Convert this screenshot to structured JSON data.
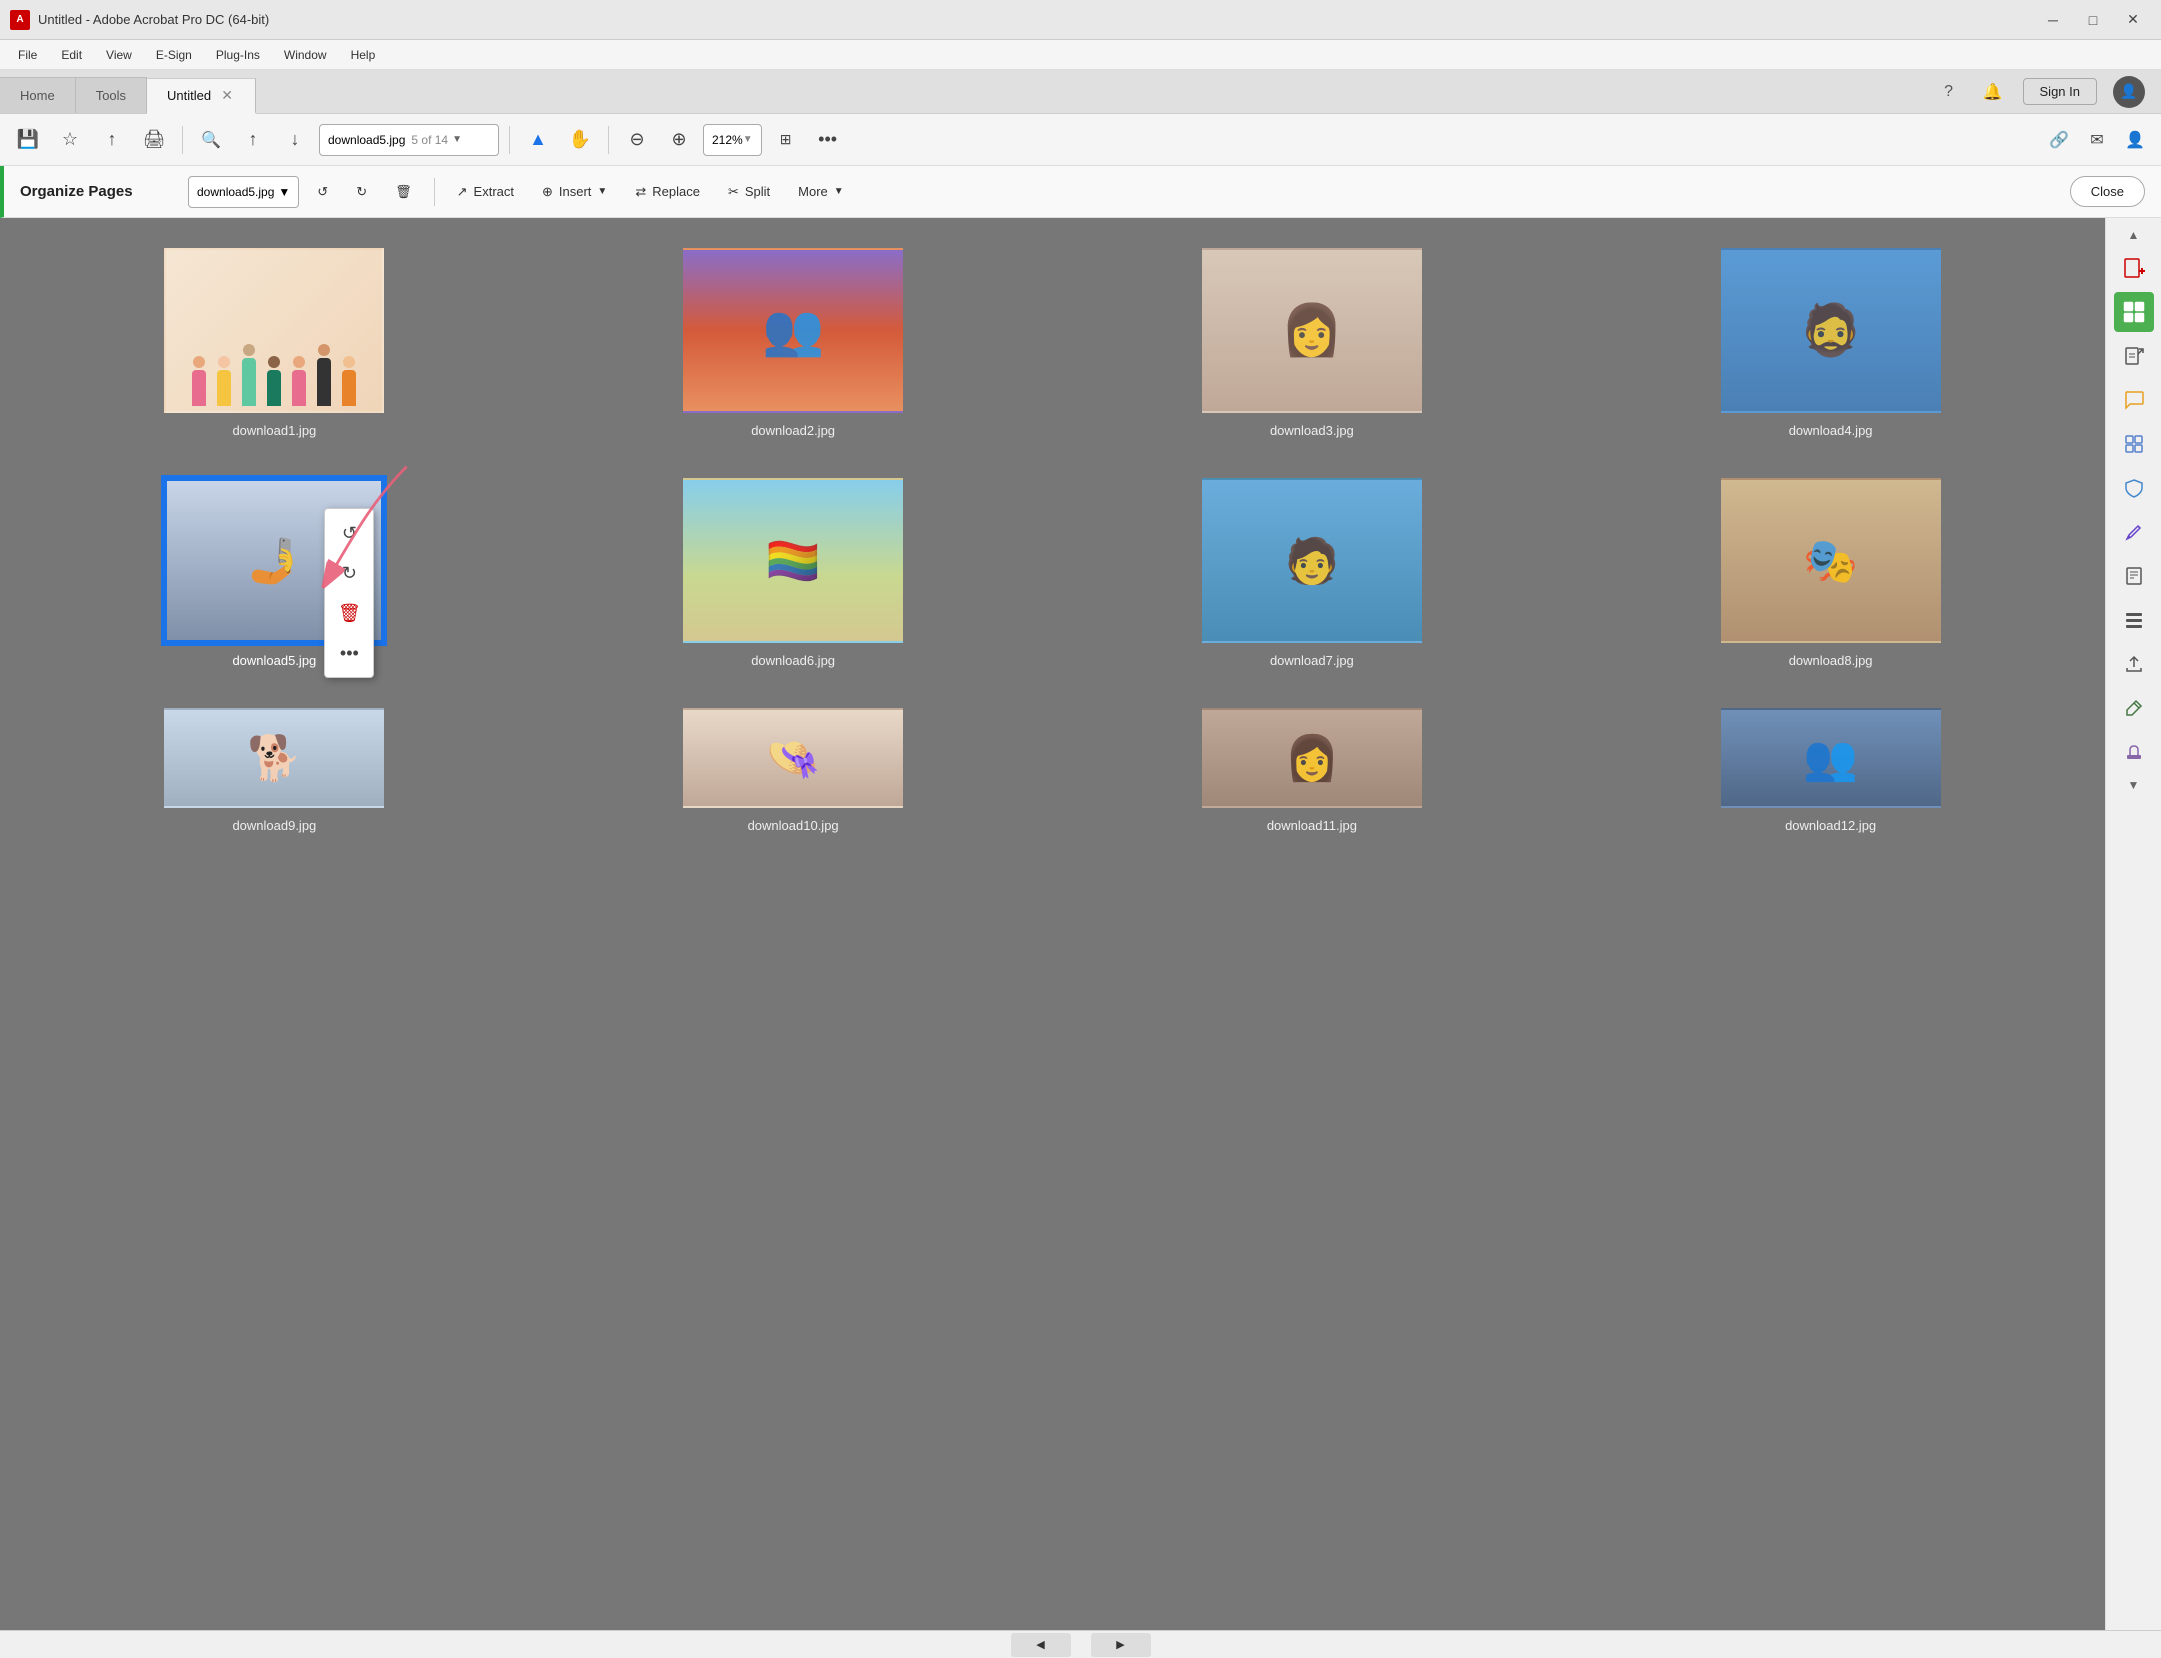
{
  "window": {
    "title": "Untitled - Adobe Acrobat Pro DC (64-bit)",
    "icon": "A",
    "controls": [
      "minimize",
      "maximize",
      "close"
    ]
  },
  "menubar": {
    "items": [
      "File",
      "Edit",
      "View",
      "E-Sign",
      "Plug-Ins",
      "Window",
      "Help"
    ]
  },
  "tabs": {
    "items": [
      {
        "label": "Home",
        "active": false,
        "closable": false
      },
      {
        "label": "Tools",
        "active": false,
        "closable": false
      },
      {
        "label": "Untitled",
        "active": true,
        "closable": true
      }
    ],
    "actions": {
      "help": "?",
      "notifications": "🔔",
      "sign_in": "Sign In"
    }
  },
  "toolbar": {
    "file_name": "download5.jpg",
    "page_info": "5 of 14",
    "zoom": "212%",
    "more_icon": "•••"
  },
  "organize_bar": {
    "title": "Organize Pages",
    "file_select": "download5.jpg",
    "actions": {
      "rotate_left": "↺",
      "rotate_right": "↻",
      "delete": "🗑",
      "extract": "Extract",
      "insert": "Insert",
      "replace": "Replace",
      "split": "Split",
      "more": "More"
    },
    "close_label": "Close"
  },
  "pages": [
    {
      "id": 1,
      "label": "download1.jpg",
      "thumb_type": "illustration",
      "selected": false
    },
    {
      "id": 2,
      "label": "download2.jpg",
      "thumb_type": "group_photo",
      "selected": false
    },
    {
      "id": 3,
      "label": "download3.jpg",
      "thumb_type": "portrait_woman",
      "selected": false
    },
    {
      "id": 4,
      "label": "download4.jpg",
      "thumb_type": "portrait_man_glasses",
      "selected": false
    },
    {
      "id": 5,
      "label": "download5.jpg",
      "thumb_type": "group_selfie",
      "selected": true
    },
    {
      "id": 6,
      "label": "download6.jpg",
      "thumb_type": "woman_flag",
      "selected": false
    },
    {
      "id": 7,
      "label": "download7.jpg",
      "thumb_type": "man_white_shirt",
      "selected": false
    },
    {
      "id": 8,
      "label": "download8.jpg",
      "thumb_type": "colorful_hats",
      "selected": false
    },
    {
      "id": 9,
      "label": "download9.jpg",
      "thumb_type": "dog",
      "selected": false
    },
    {
      "id": 10,
      "label": "download10.jpg",
      "thumb_type": "woman_hat",
      "selected": false
    },
    {
      "id": 11,
      "label": "download11.jpg",
      "thumb_type": "woman_smile",
      "selected": false
    },
    {
      "id": 12,
      "label": "download12.jpg",
      "thumb_type": "crowd",
      "selected": false
    }
  ],
  "context_menu": {
    "items": [
      {
        "icon": "↺",
        "label": "rotate_left",
        "type": "rotate"
      },
      {
        "icon": "↻",
        "label": "rotate_right",
        "type": "rotate"
      },
      {
        "icon": "🗑",
        "label": "delete",
        "type": "delete"
      },
      {
        "icon": "•••",
        "label": "more",
        "type": "more"
      }
    ]
  },
  "right_sidebar": {
    "icons": [
      {
        "name": "add-pdf",
        "symbol": "+",
        "color": "red",
        "active": false
      },
      {
        "name": "organize-pages",
        "symbol": "▦",
        "color": "green",
        "active": true
      },
      {
        "name": "export-pdf",
        "symbol": "↗",
        "color": "default",
        "active": false
      },
      {
        "name": "comment",
        "symbol": "💬",
        "color": "default",
        "active": false
      },
      {
        "name": "scan",
        "symbol": "⊞",
        "color": "default",
        "active": false
      },
      {
        "name": "protect",
        "symbol": "🛡",
        "color": "default",
        "active": false
      },
      {
        "name": "sign",
        "symbol": "✏",
        "color": "default",
        "active": false
      },
      {
        "name": "pages",
        "symbol": "📄",
        "color": "default",
        "active": false
      },
      {
        "name": "more-tools",
        "symbol": "📋",
        "color": "default",
        "active": false
      },
      {
        "name": "share",
        "symbol": "↑",
        "color": "default",
        "active": false
      },
      {
        "name": "edit",
        "symbol": "✒",
        "color": "default",
        "active": false
      },
      {
        "name": "stamp",
        "symbol": "🔷",
        "color": "default",
        "active": false
      }
    ]
  },
  "colors": {
    "accent_blue": "#1a73e8",
    "accent_green": "#4caf50",
    "accent_red": "#cc0000",
    "selected_border": "#1a73e8",
    "selected_bg": "#dce8fa",
    "toolbar_bg": "#f5f5f5",
    "main_bg": "#777777"
  }
}
